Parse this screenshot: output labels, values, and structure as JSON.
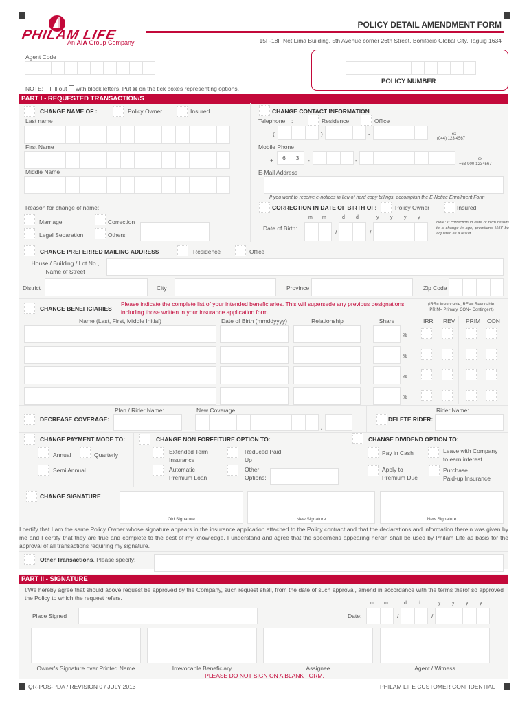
{
  "header": {
    "brand": "PHILAM LIFE",
    "brand_tagline_prefix": "An ",
    "brand_tagline_bold": "AIA",
    "brand_tagline_suffix": " Group Company",
    "form_title": "POLICY DETAIL AMENDMENT FORM",
    "address": "15F-18F Net Lima Building, 5th Avenue corner 26th Street, Bonifacio Global City, Taguig 1634",
    "agent_code_label": "Agent Code",
    "policy_number_label": "POLICY NUMBER",
    "note_label": "NOTE:",
    "note_text_1": "Fill out",
    "note_text_2": "with block letters. Put",
    "note_text_3": "on the tick boxes representing options.",
    "tick_glyph": "⊠"
  },
  "part1": {
    "title": "PART I - REQUESTED TRANSACTION/S",
    "change_name": {
      "label": "CHANGE NAME OF :",
      "option_owner": "Policy Owner",
      "option_insured": "Insured",
      "last_name": "Last name",
      "first_name": "First Name",
      "middle_name": "Middle Name",
      "reason_label": "Reason for change of name:",
      "reasons": [
        "Marriage",
        "Correction",
        "Legal Separation",
        "Others"
      ]
    },
    "contact": {
      "label": "CHANGE CONTACT INFORMATION",
      "telephone": "Telephone",
      "colon": ":",
      "residence": "Residence",
      "office": "Office",
      "open_paren": "(",
      "close_paren": ")",
      "dash": "-",
      "tel_example_ex": "ex",
      "tel_example": "(044) 123-4567",
      "mobile": "Mobile Phone",
      "plus": "+",
      "mobile_prefix": [
        "6",
        "3"
      ],
      "mobile_example_ex": "ex",
      "mobile_example": "+63-900-1234567",
      "email": "E-Mail Address",
      "enotice": "If you want to receive e-notices in lieu of hard copy billings, accomplish the E-Notice Enrollment Form"
    },
    "dob_correction": {
      "label": "CORRECTION IN DATE OF BIRTH OF:",
      "option_owner": "Policy Owner",
      "option_insured": "Insured",
      "dob_label": "Date of Birth:",
      "date_letters": [
        "m",
        "m",
        "d",
        "d",
        "y",
        "y",
        "y",
        "y"
      ],
      "slash": "/",
      "note": "Note: If correction in date of birth results to a change in age, premiums MAY be adjusted as a result."
    },
    "mailing": {
      "label": "CHANGE PREFERRED MAILING ADDRESS",
      "residence": "Residence",
      "office": "Office",
      "house_line1": "House / Building / Lot No.,",
      "house_line2": "Name of Street",
      "district": "District",
      "city": "City",
      "province": "Province",
      "zip": "Zip Code"
    },
    "beneficiaries": {
      "label": "CHANGE BENEFICIARIES",
      "instruction_1": "Please indicate the ",
      "instruction_complete": "complete",
      "instruction_space": " ",
      "instruction_list": "list",
      "instruction_2": " of your intended beneficiaries. This will supersede any previous designations",
      "instruction_3": "including those written in your insurance application form.",
      "legend_1": "(IRR= Irrevocable, REV= Revocable,",
      "legend_2": "PRIM= Primary, CON= Contingent)",
      "columns": {
        "name": "Name (Last, First, Middle Initial)",
        "dob": "Date of Birth (mmddyyyy)",
        "relationship": "Relationship",
        "share": "Share",
        "irr": "IRR",
        "rev": "REV",
        "prim": "PRIM",
        "con": "CON"
      },
      "percent": "%",
      "rows": [
        {
          "name": "",
          "dob": "",
          "relationship": "",
          "share": ""
        },
        {
          "name": "",
          "dob": "",
          "relationship": "",
          "share": ""
        },
        {
          "name": "",
          "dob": "",
          "relationship": "",
          "share": ""
        },
        {
          "name": "",
          "dob": "",
          "relationship": "",
          "share": ""
        }
      ]
    },
    "decrease_coverage": {
      "label": "DECREASE COVERAGE:",
      "plan_rider": "Plan / Rider Name:",
      "new_coverage": "New Coverage:",
      "decimal": ".",
      "delete_rider": "DELETE RIDER:",
      "rider_name": "Rider Name:"
    },
    "payment_mode": {
      "label": "CHANGE PAYMENT MODE TO:",
      "annual": "Annual",
      "quarterly": "Quarterly",
      "semi_annual": "Semi Annual"
    },
    "non_forfeiture": {
      "label": "CHANGE NON FORFEITURE OPTION TO:",
      "eti_1": "Extended Term",
      "eti_2": "Insurance",
      "rpu_1": "Reduced Paid",
      "rpu_2": "Up",
      "apl_1": "Automatic",
      "apl_2": "Premium Loan",
      "other_1": "Other",
      "other_2": "Options:"
    },
    "dividend": {
      "label": "CHANGE DIVIDEND OPTION TO:",
      "cash": "Pay in Cash",
      "leave_1": "Leave with Company",
      "leave_2": "to earn interest",
      "apply_1": "Apply to",
      "apply_2": "Premium Due",
      "purchase_1": "Purchase",
      "purchase_2": "Paid-up Insurance"
    },
    "signature": {
      "label": "CHANGE SIGNATURE",
      "old": "Old Signature",
      "new": "New Signature",
      "certify": "I certify that I am the same Policy Owner whose signature appears in the insurance application attached to the Policy contract and that the declarations and information therein was given by me and I certify that they are true and complete to the best of my knowledge. I understand and agree that the specimens appearing herein shall be used by Philam Life as basis for the approval of all transactions requiring my signature."
    },
    "other": {
      "label_bold": "Other Transactions",
      "label_rest": ". Please specify:"
    }
  },
  "part2": {
    "title": "PART II - SIGNATURE",
    "agreement": "I/We hereby agree that should above request be approved by the Company, such request shall, from the date of such approval, amend in accordance with the terms therof so approved the Policy to which the request refers.",
    "place_signed": "Place Signed",
    "date_label": "Date:",
    "date_letters": [
      "m",
      "m",
      "d",
      "d",
      "y",
      "y",
      "y",
      "y"
    ],
    "slash": "/",
    "signatories": [
      "Owner's Signature over Printed Name",
      "Irrevocable Beneficiary",
      "Assignee",
      "Agent / Witness"
    ],
    "warning": "PLEASE DO NOT SIGN ON A BLANK FORM."
  },
  "footer": {
    "form_code": "QR-POS-PDA / REVISION 0 / JULY 2013",
    "confidential": "PHILAM LIFE CUSTOMER CONFIDENTIAL"
  },
  "colors": {
    "brand_red": "#c3093a",
    "panel_gray": "#f5f5f4",
    "marker": "#3d3d3d"
  }
}
